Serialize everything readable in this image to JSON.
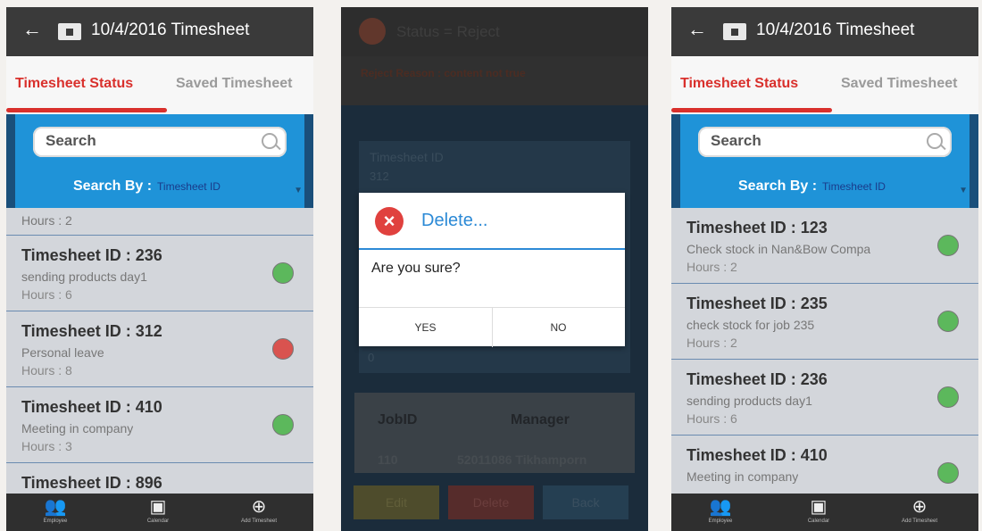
{
  "header": {
    "title": "10/4/2016 Timesheet",
    "back": "←"
  },
  "tabs": {
    "status": "Timesheet Status",
    "saved": "Saved Timesheet"
  },
  "search": {
    "placeholder": "Search",
    "by_label": "Search By :",
    "by_value": "Timesheet ID"
  },
  "colors": {
    "accent": "#d9302c",
    "panel": "#1f93d8",
    "green": "#5cb85c",
    "red": "#d9534f"
  },
  "screen1": {
    "partial_hours": "Hours : 2",
    "items": [
      {
        "id": "Timesheet ID : 236",
        "desc": "sending products day1",
        "hours": "Hours : 6",
        "status": "green"
      },
      {
        "id": "Timesheet ID : 312",
        "desc": "Personal leave",
        "hours": "Hours : 8",
        "status": "red"
      },
      {
        "id": "Timesheet ID : 410",
        "desc": "Meeting in company",
        "hours": "Hours : 3",
        "status": "green"
      },
      {
        "id": "Timesheet ID : 896",
        "desc": "",
        "hours": "",
        "status": "partial"
      }
    ]
  },
  "screen2": {
    "title": "Status = Reject",
    "reason": "Reject Reason : content not true",
    "field_label": "Timesheet ID",
    "field_value": "312",
    "zero": "0",
    "job_headers": {
      "job": "JobID",
      "manager": "Manager"
    },
    "job_row": {
      "job": "110",
      "manager": "52011086 Tikhamporn"
    },
    "buttons": {
      "edit": "Edit",
      "delete": "Delete",
      "back": "Back"
    },
    "dialog": {
      "title": "Delete...",
      "message": "Are you sure?",
      "yes": "YES",
      "no": "NO"
    }
  },
  "screen3": {
    "items": [
      {
        "id": "Timesheet ID : 123",
        "desc": "Check stock in Nan&Bow Compa",
        "hours": "Hours : 2",
        "status": "green"
      },
      {
        "id": "Timesheet ID : 235",
        "desc": "check stock for job 235",
        "hours": "Hours : 2",
        "status": "green"
      },
      {
        "id": "Timesheet ID : 236",
        "desc": "sending products day1",
        "hours": "Hours : 6",
        "status": "green"
      },
      {
        "id": "Timesheet ID : 410",
        "desc": "Meeting in company",
        "hours": "",
        "status": "green"
      }
    ]
  },
  "nav": {
    "employee": "Employee",
    "calendar": "Calendar",
    "add": "Add Timesheet"
  }
}
